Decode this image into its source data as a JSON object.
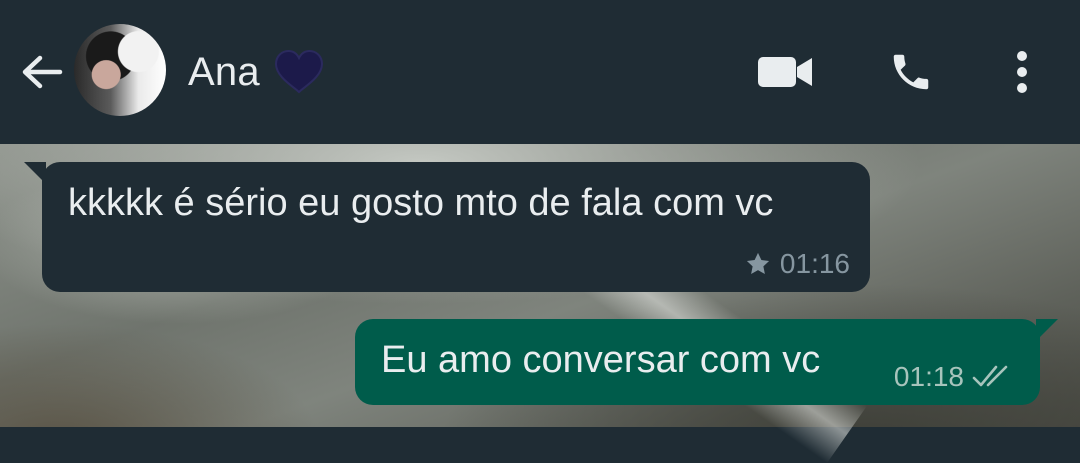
{
  "header": {
    "contact_name": "Ana",
    "icons": {
      "back": "arrow-left-icon",
      "avatar": "avatar",
      "status_emoji": "heart-icon",
      "video": "video-call-icon",
      "call": "phone-icon",
      "more": "more-vertical-icon"
    }
  },
  "messages": [
    {
      "direction": "incoming",
      "text": "kkkkk é sério eu gosto mto de fala com vc",
      "time": "01:16",
      "starred": true
    },
    {
      "direction": "outgoing",
      "text": "Eu amo conversar com vc",
      "time": "01:18",
      "status": "delivered"
    }
  ],
  "colors": {
    "header_bg": "#1f2c34",
    "incoming_bubble": "#1f2c34",
    "outgoing_bubble": "#005c4b",
    "text": "#e9edef",
    "meta_text": "#8696a0",
    "heart": "#1c1a4a"
  }
}
